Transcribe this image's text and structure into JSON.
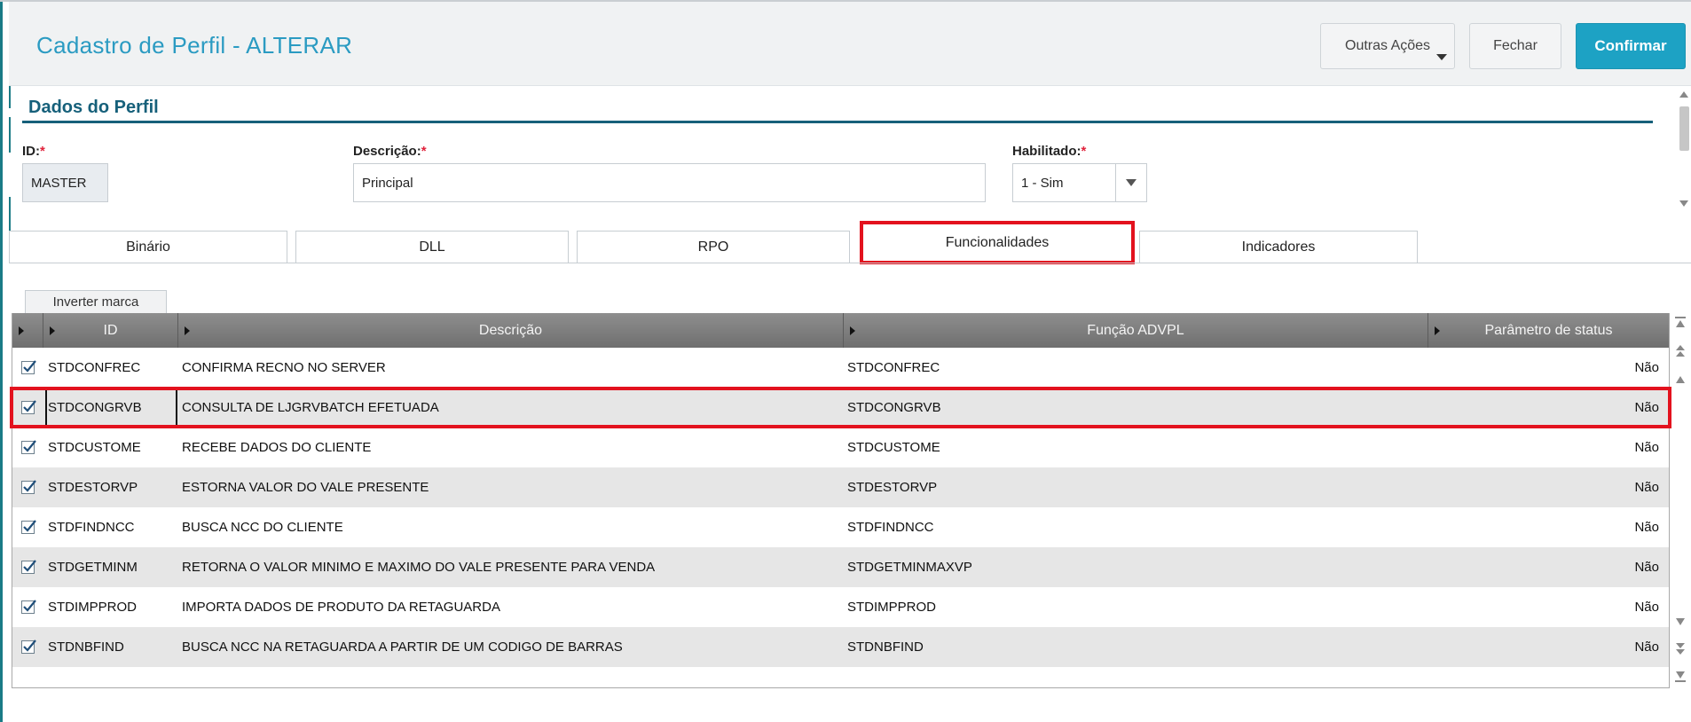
{
  "header": {
    "title": "Cadastro de Perfil - ALTERAR",
    "other_actions_label": "Outras Ações",
    "close_label": "Fechar",
    "confirm_label": "Confirmar"
  },
  "section": {
    "title": "Dados do Perfil"
  },
  "form": {
    "id": {
      "label": "ID:",
      "required_mark": "*",
      "value": "MASTER"
    },
    "description": {
      "label": "Descrição:",
      "required_mark": "*",
      "value": "Principal"
    },
    "enabled": {
      "label": "Habilitado:",
      "required_mark": "*",
      "value": "1 - Sim"
    }
  },
  "tabs": [
    {
      "label": "Binário",
      "active": false
    },
    {
      "label": "DLL",
      "active": false
    },
    {
      "label": "RPO",
      "active": false
    },
    {
      "label": "Funcionalidades",
      "active": true
    },
    {
      "label": "Indicadores",
      "active": false
    }
  ],
  "grid": {
    "invert_label": "Inverter marca",
    "columns": [
      "ID",
      "Descrição",
      "Função ADVPL",
      "Parâmetro de status"
    ],
    "rows": [
      {
        "checked": true,
        "id": "STDCONFREC",
        "desc": "CONFIRMA RECNO NO SERVER",
        "func": "STDCONFREC",
        "status": "Não"
      },
      {
        "checked": true,
        "id": "STDCONGRVB",
        "desc": "CONSULTA DE LJGRVBATCH EFETUADA",
        "func": "STDCONGRVB",
        "status": "Não"
      },
      {
        "checked": true,
        "id": "STDCUSTOME",
        "desc": "RECEBE DADOS DO CLIENTE",
        "func": "STDCUSTOME",
        "status": "Não"
      },
      {
        "checked": true,
        "id": "STDESTORVP",
        "desc": "ESTORNA VALOR DO VALE PRESENTE",
        "func": "STDESTORVP",
        "status": "Não"
      },
      {
        "checked": true,
        "id": "STDFINDNCC",
        "desc": "BUSCA NCC DO CLIENTE",
        "func": "STDFINDNCC",
        "status": "Não"
      },
      {
        "checked": true,
        "id": "STDGETMINM",
        "desc": "RETORNA O VALOR MINIMO E MAXIMO DO VALE PRESENTE PARA VENDA",
        "func": "STDGETMINMAXVP",
        "status": "Não"
      },
      {
        "checked": true,
        "id": "STDIMPPROD",
        "desc": "IMPORTA DADOS DE PRODUTO DA RETAGUARDA",
        "func": "STDIMPPROD",
        "status": "Não"
      },
      {
        "checked": true,
        "id": "STDNBFIND",
        "desc": "BUSCA NCC NA RETAGUARDA A PARTIR DE UM CODIGO DE BARRAS",
        "func": "STDNBFIND",
        "status": "Não"
      }
    ]
  },
  "colors": {
    "title": "#2b9bc2",
    "section": "#16607a",
    "confirm_bg": "#1da2c4",
    "highlight": "#e3121e"
  }
}
